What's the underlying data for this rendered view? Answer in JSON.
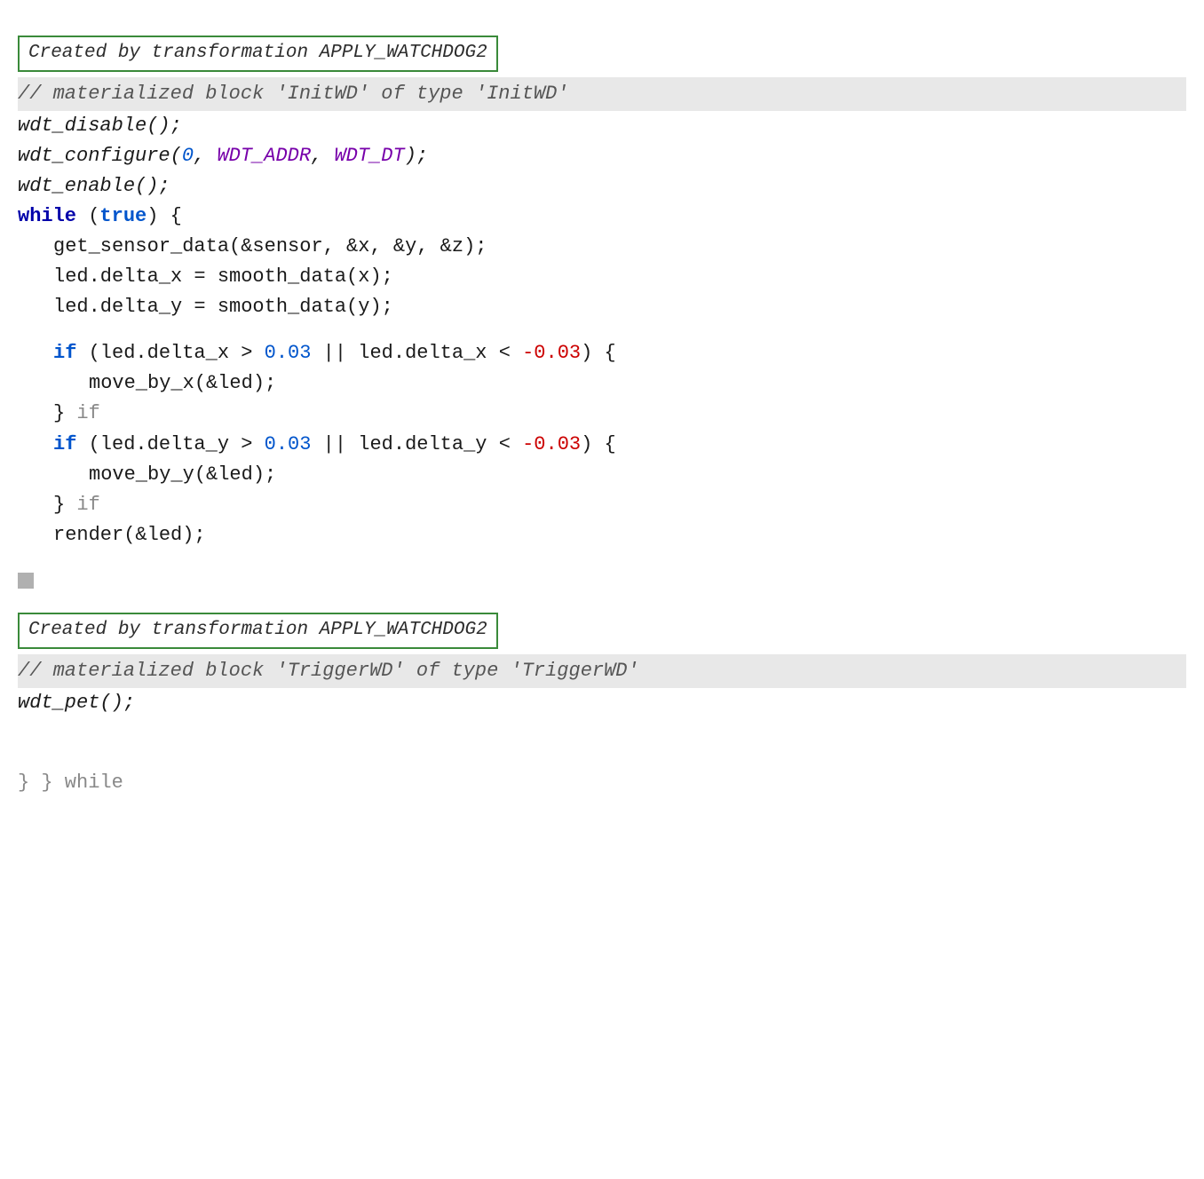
{
  "page": {
    "transformation_label_1": "Created by transformation  APPLY_WATCHDOG2",
    "comment_1": "// materialized block 'InitWD' of type 'InitWD'",
    "line_wdt_disable": "wdt_disable();",
    "line_wdt_configure_pre": "wdt_configure(",
    "line_wdt_configure_arg1": "0",
    "line_wdt_configure_sep": ", ",
    "line_wdt_configure_arg2": "WDT_ADDR",
    "line_wdt_configure_arg3": "WDT_DT",
    "line_wdt_configure_post": ");",
    "line_wdt_enable": "wdt_enable();",
    "line_while": "while",
    "line_while_true": "(true)",
    "line_while_brace": " {",
    "line_get_sensor": "get_sensor_data(&sensor, &x, &y, &z);",
    "line_led_delta_x": "led.delta_x = smooth_data(x);",
    "line_led_delta_y": "led.delta_y = smooth_data(y);",
    "line_if_x_pre": "if (led.delta_x > ",
    "line_if_x_val1": "0.03",
    "line_if_x_mid": " || led.delta_x < ",
    "line_if_x_val2": "-0.03",
    "line_if_x_post": ") {",
    "line_move_by_x": "move_by_x(&led);",
    "line_close_if_x": "} if",
    "line_if_y_pre": "if (led.delta_y > ",
    "line_if_y_val1": "0.03",
    "line_if_y_mid": " || led.delta_y < ",
    "line_if_y_val2": "-0.03",
    "line_if_y_post": ") {",
    "line_move_by_y": "move_by_y(&led);",
    "line_close_if_y": "} if",
    "line_render": "render(&led);",
    "transformation_label_2": "Created by transformation  APPLY_WATCHDOG2",
    "comment_2": "// materialized block 'TriggerWD' of type 'TriggerWD'",
    "line_wdt_pet": "wdt_pet();",
    "closing_while": "} while"
  }
}
